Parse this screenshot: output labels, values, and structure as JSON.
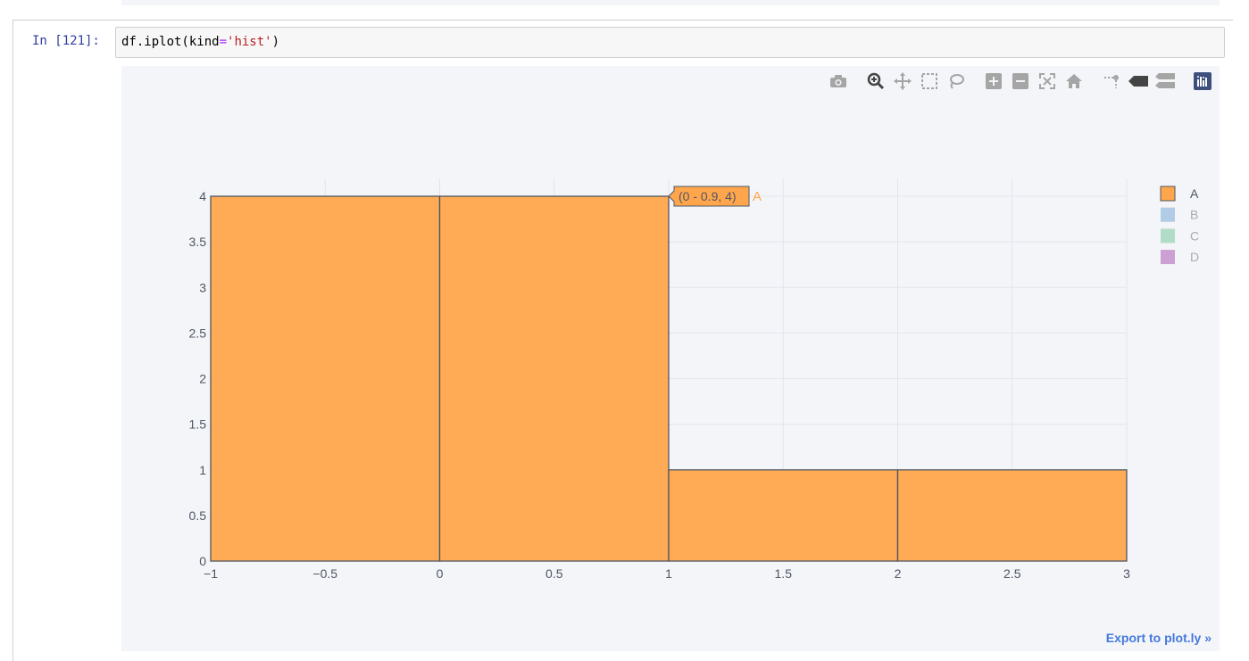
{
  "notebook": {
    "prompt": "In [121]:",
    "code": {
      "pre": "df.iplot(kind",
      "op": "=",
      "str": "'hist'",
      "post": ")"
    }
  },
  "modebar": {
    "icons": [
      "camera-icon",
      "zoom-icon",
      "pan-icon",
      "box-select-icon",
      "lasso-select-icon",
      "zoom-in-icon",
      "zoom-out-icon",
      "autoscale-icon",
      "reset-axes-icon",
      "spike-lines-icon",
      "hover-closest-icon",
      "hover-compare-icon",
      "plotly-logo-icon"
    ]
  },
  "export_label": "Export to plot.ly »",
  "tooltip": {
    "text": "(0 - 0.9, 4)",
    "series": "A"
  },
  "colors": {
    "bar_fill": "#FFA64D",
    "bar_stroke": "#4D5663",
    "plot_bg": "#F4F5F9",
    "grid": "#E1E5ED",
    "axis_text": "#4D5663",
    "link": "#447ADB"
  },
  "chart_data": {
    "type": "bar",
    "title": "",
    "xlabel": "",
    "ylabel": "",
    "xlim": [
      -1,
      3
    ],
    "ylim": [
      0,
      4
    ],
    "x_ticks": [
      -1,
      -0.5,
      0,
      0.5,
      1,
      1.5,
      2,
      2.5,
      3
    ],
    "x_tick_labels": [
      "−1",
      "−0.5",
      "0",
      "0.5",
      "1",
      "1.5",
      "2",
      "2.5",
      "3"
    ],
    "y_ticks": [
      0,
      0.5,
      1,
      1.5,
      2,
      2.5,
      3,
      3.5,
      4
    ],
    "y_tick_labels": [
      "0",
      "0.5",
      "1",
      "1.5",
      "2",
      "2.5",
      "3",
      "3.5",
      "4"
    ],
    "grid": true,
    "legend_position": "top-right",
    "series": [
      {
        "name": "A",
        "color": "#FFA64D",
        "visible": true,
        "bins": [
          [
            -1,
            0
          ],
          [
            0,
            1
          ],
          [
            1,
            2
          ],
          [
            2,
            3
          ]
        ],
        "values": [
          4,
          4,
          1,
          1
        ]
      },
      {
        "name": "B",
        "color": "#A7C4E2",
        "visible": false,
        "bins": [],
        "values": []
      },
      {
        "name": "C",
        "color": "#A5D8BF",
        "visible": false,
        "bins": [],
        "values": []
      },
      {
        "name": "D",
        "color": "#C490CC",
        "visible": false,
        "bins": [],
        "values": []
      }
    ]
  }
}
